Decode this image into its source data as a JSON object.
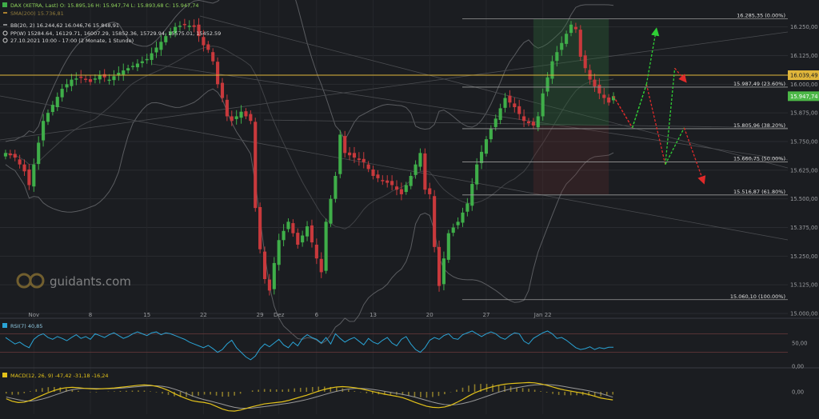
{
  "header": {
    "symbol_line": "DAX (XETRA, Last)  O: 15.895,16  H: 15.947,74  L: 15.893,68  C: 15.947,74",
    "sma_line": "SMA(200)  15.736,81",
    "bb_line": "BB(20, 2)  16.244,62  16.046,76  15.848,91",
    "pp_line": "PP(W)  15284.64, 16129.71, 16007.29, 15852.36, 15729.94, 15575.01, 15452.59",
    "period_line": "27.10.2021 10:00 - 17:00  (2 Monate, 1 Stunde)"
  },
  "watermark": "guidants.com",
  "colors": {
    "background": "#1b1d21",
    "bull": "#3fae49",
    "bear": "#c8393c",
    "rsi": "#2aa4d6",
    "macd": "#e3c21a",
    "signal": "#9a9a9a",
    "price_badge": "#4cb847",
    "level_badge": "#e0b63a",
    "forecast_up": "#2fcf35",
    "forecast_down": "#e02a2a"
  },
  "chart_data": {
    "type": "candlestick",
    "instrument": "DAX (XETRA, Last)",
    "y_range": [
      15000,
      16350
    ],
    "y_ticks": [
      "16.250,00",
      "16.125,00",
      "16.000,00",
      "15.875,00",
      "15.750,00",
      "15.625,00",
      "15.500,00",
      "15.375,00",
      "15.250,00",
      "15.125,00",
      "15.000,00"
    ],
    "y_tick_values": [
      16250,
      16125,
      16000,
      15875,
      15750,
      15625,
      15500,
      15375,
      15250,
      15125,
      15000
    ],
    "x_ticks": [
      "Nov",
      "8",
      "15",
      "22",
      "29",
      "Dez",
      "6",
      "13",
      "20",
      "27",
      "Jan 22"
    ],
    "x_tick_index": [
      6,
      18,
      30,
      42,
      54,
      58,
      66,
      78,
      90,
      102,
      114
    ],
    "n_bars": 130,
    "close_path": [
      [
        0,
        15700
      ],
      [
        2,
        15680
      ],
      [
        4,
        15620
      ],
      [
        5,
        15560
      ],
      [
        6,
        15650
      ],
      [
        8,
        15840
      ],
      [
        10,
        15910
      ],
      [
        12,
        15980
      ],
      [
        14,
        16020
      ],
      [
        16,
        16030
      ],
      [
        18,
        16010
      ],
      [
        20,
        16040
      ],
      [
        22,
        16020
      ],
      [
        24,
        16050
      ],
      [
        26,
        16070
      ],
      [
        28,
        16090
      ],
      [
        30,
        16110
      ],
      [
        32,
        16160
      ],
      [
        34,
        16210
      ],
      [
        36,
        16250
      ],
      [
        38,
        16260
      ],
      [
        40,
        16250
      ],
      [
        42,
        16170
      ],
      [
        43,
        16150
      ],
      [
        44,
        16100
      ],
      [
        45,
        16000
      ],
      [
        46,
        15940
      ],
      [
        47,
        15860
      ],
      [
        48,
        15840
      ],
      [
        50,
        15880
      ],
      [
        52,
        15840
      ],
      [
        53,
        15460
      ],
      [
        54,
        15280
      ],
      [
        55,
        15150
      ],
      [
        56,
        15100
      ],
      [
        57,
        15220
      ],
      [
        58,
        15320
      ],
      [
        60,
        15400
      ],
      [
        62,
        15300
      ],
      [
        64,
        15380
      ],
      [
        66,
        15240
      ],
      [
        67,
        15180
      ],
      [
        68,
        15400
      ],
      [
        70,
        15600
      ],
      [
        71,
        15780
      ],
      [
        72,
        15700
      ],
      [
        74,
        15680
      ],
      [
        76,
        15660
      ],
      [
        78,
        15600
      ],
      [
        80,
        15580
      ],
      [
        82,
        15560
      ],
      [
        84,
        15520
      ],
      [
        86,
        15600
      ],
      [
        88,
        15700
      ],
      [
        89,
        15540
      ],
      [
        90,
        15520
      ],
      [
        91,
        15290
      ],
      [
        92,
        15120
      ],
      [
        93,
        15240
      ],
      [
        94,
        15350
      ],
      [
        96,
        15400
      ],
      [
        98,
        15480
      ],
      [
        100,
        15650
      ],
      [
        102,
        15760
      ],
      [
        104,
        15850
      ],
      [
        106,
        15940
      ],
      [
        108,
        15900
      ],
      [
        110,
        15840
      ],
      [
        112,
        15820
      ],
      [
        113,
        15860
      ],
      [
        114,
        15960
      ],
      [
        116,
        16100
      ],
      [
        118,
        16180
      ],
      [
        120,
        16260
      ],
      [
        121,
        16240
      ],
      [
        122,
        16120
      ],
      [
        124,
        16020
      ],
      [
        126,
        15960
      ],
      [
        128,
        15920
      ],
      [
        129,
        15948
      ]
    ],
    "fibonacci": [
      {
        "label": "16.285,35 (0.00%)",
        "value": 16285.35
      },
      {
        "label": "15.987,49 (23.60%)",
        "value": 15987.49
      },
      {
        "label": "15.805,96 (38.20%)",
        "value": 15805.96
      },
      {
        "label": "15.660,75 (50.00%)",
        "value": 15660.75
      },
      {
        "label": "15.516,87 (61.80%)",
        "value": 15516.87
      },
      {
        "label": "15.060,10 (100.00%)",
        "value": 15060.1
      }
    ],
    "horizontal_level": {
      "label": "16.039,49",
      "value": 16039.49
    },
    "last_price": {
      "label": "15.947,74",
      "value": 15947.74
    },
    "forecast_paths": [
      {
        "dir": "down",
        "points": [
          [
            129,
            15948
          ],
          [
            133,
            15810
          ],
          [
            136,
            16000
          ],
          [
            140,
            15650
          ],
          [
            144,
            15810
          ],
          [
            148,
            15580
          ]
        ]
      },
      {
        "dir": "up",
        "points": [
          [
            129,
            15948
          ],
          [
            133,
            15810
          ],
          [
            136,
            16000
          ],
          [
            138,
            16230
          ]
        ]
      },
      {
        "dir": "up",
        "points": [
          [
            140,
            15650
          ],
          [
            142,
            16070
          ],
          [
            144,
            16020
          ]
        ]
      }
    ],
    "rsi": {
      "label": "RSI(7)  40,85",
      "range": [
        0,
        100
      ],
      "ticks": [
        "50,00",
        "0,00"
      ],
      "tick_values": [
        50,
        0
      ],
      "bands": [
        30,
        70
      ],
      "values": [
        62,
        55,
        48,
        52,
        45,
        40,
        58,
        66,
        70,
        62,
        58,
        64,
        60,
        55,
        62,
        68,
        60,
        64,
        58,
        70,
        66,
        62,
        68,
        72,
        66,
        60,
        64,
        70,
        74,
        70,
        66,
        72,
        74,
        68,
        72,
        70,
        66,
        62,
        58,
        52,
        48,
        44,
        40,
        45,
        38,
        30,
        36,
        48,
        56,
        40,
        30,
        20,
        14,
        22,
        38,
        48,
        42,
        50,
        58,
        46,
        40,
        52,
        44,
        60,
        68,
        62,
        58,
        50,
        62,
        48,
        70,
        60,
        52,
        58,
        62,
        54,
        46,
        60,
        52,
        48,
        56,
        62,
        50,
        44,
        58,
        64,
        48,
        36,
        30,
        40,
        56,
        62,
        58,
        66,
        70,
        60,
        58,
        68,
        72,
        76,
        70,
        64,
        70,
        74,
        70,
        62,
        58,
        66,
        72,
        70,
        54,
        48,
        60,
        66,
        72,
        76,
        70,
        60,
        62,
        56,
        48,
        40,
        36,
        38,
        42,
        36,
        40,
        38,
        41,
        41
      ]
    },
    "macd": {
      "label": "MACD(12, 26, 9)  -47,42  -31,18  -16,24",
      "ticks": [
        "0,00"
      ],
      "tick_values": [
        0
      ],
      "macd_line": [
        -40,
        -55,
        -62,
        -60,
        -50,
        -35,
        -20,
        -5,
        8,
        18,
        24,
        26,
        24,
        20,
        18,
        16,
        18,
        20,
        22,
        26,
        30,
        34,
        38,
        40,
        38,
        32,
        22,
        8,
        -10,
        -26,
        -40,
        -52,
        -58,
        -62,
        -70,
        -85,
        -100,
        -110,
        -112,
        -106,
        -96,
        -86,
        -78,
        -70,
        -66,
        -62,
        -58,
        -50,
        -40,
        -30,
        -20,
        -8,
        4,
        14,
        22,
        28,
        30,
        28,
        24,
        18,
        10,
        2,
        -6,
        -14,
        -20,
        -26,
        -34,
        -46,
        -60,
        -72,
        -84,
        -90,
        -92,
        -88,
        -78,
        -62,
        -44,
        -24,
        -6,
        8,
        20,
        30,
        38,
        44,
        48,
        50,
        52,
        54,
        52,
        46,
        38,
        28,
        18,
        10,
        4,
        -2,
        -8,
        -16,
        -26,
        -36,
        -42,
        -47
      ],
      "signal_line": [
        -30,
        -38,
        -46,
        -52,
        -54,
        -50,
        -42,
        -32,
        -20,
        -8,
        4,
        12,
        18,
        20,
        20,
        19,
        18,
        18,
        19,
        21,
        24,
        27,
        30,
        33,
        35,
        35,
        32,
        26,
        16,
        4,
        -10,
        -24,
        -36,
        -46,
        -54,
        -63,
        -72,
        -82,
        -90,
        -95,
        -96,
        -94,
        -90,
        -86,
        -81,
        -76,
        -71,
        -66,
        -60,
        -53,
        -45,
        -36,
        -26,
        -16,
        -6,
        3,
        10,
        16,
        20,
        20,
        18,
        14,
        9,
        3,
        -3,
        -9,
        -15,
        -22,
        -30,
        -40,
        -50,
        -60,
        -68,
        -74,
        -76,
        -74,
        -68,
        -60,
        -50,
        -38,
        -26,
        -14,
        -2,
        8,
        17,
        24,
        30,
        36,
        40,
        42,
        42,
        40,
        36,
        30,
        24,
        18,
        12,
        6,
        -2,
        -10,
        -20,
        -31
      ]
    }
  }
}
